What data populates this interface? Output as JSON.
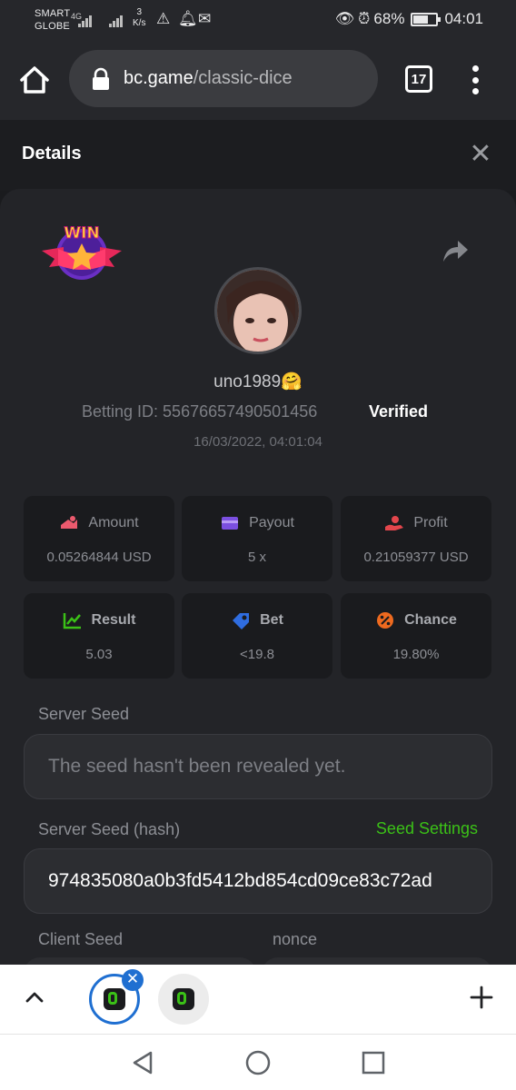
{
  "status_bar": {
    "carrier_line1": "SMART",
    "carrier_line2": "GLOBE",
    "network": "4G",
    "speed_value": "3",
    "speed_unit": "K/s",
    "battery": "68%",
    "battery_level": 0.68,
    "time": "04:01"
  },
  "browser": {
    "url_host": "bc.game",
    "url_path": "/classic-dice",
    "tab_count": "17"
  },
  "details": {
    "title": "Details",
    "username": "uno1989🤗",
    "betting_id": "Betting ID: 55676657490501456",
    "verified": "Verified",
    "timestamp": "16/03/2022, 04:01:04",
    "badge_text": "WIN"
  },
  "stats": [
    {
      "label": "Amount",
      "value": "0.05264844 USD",
      "icon": "amount-icon",
      "color": "#ec5a6e"
    },
    {
      "label": "Payout",
      "value": "5 x",
      "icon": "payout-icon",
      "color": "#7b4fe0"
    },
    {
      "label": "Profit",
      "value": "0.21059377 USD",
      "icon": "profit-icon",
      "color": "#e3464c"
    },
    {
      "label": "Result",
      "value": "5.03",
      "icon": "result-icon",
      "color": "#3bc117"
    },
    {
      "label": "Bet",
      "value": "<19.8",
      "icon": "bet-icon",
      "color": "#2f6de0"
    },
    {
      "label": "Chance",
      "value": "19.80%",
      "icon": "chance-icon",
      "color": "#ee6a1f"
    }
  ],
  "seeds": {
    "server_seed_label": "Server Seed",
    "server_seed_placeholder": "The seed hasn't been revealed yet.",
    "server_seed_hash_label": "Server Seed (hash)",
    "seed_settings": "Seed Settings",
    "server_seed_hash": "974835080a0b3fd5412bd854cd09ce83c72ad",
    "client_seed_label": "Client Seed",
    "nonce_label": "nonce"
  },
  "colors": {
    "accent_green": "#3bc117",
    "active_tab_blue": "#1f6fd1"
  }
}
